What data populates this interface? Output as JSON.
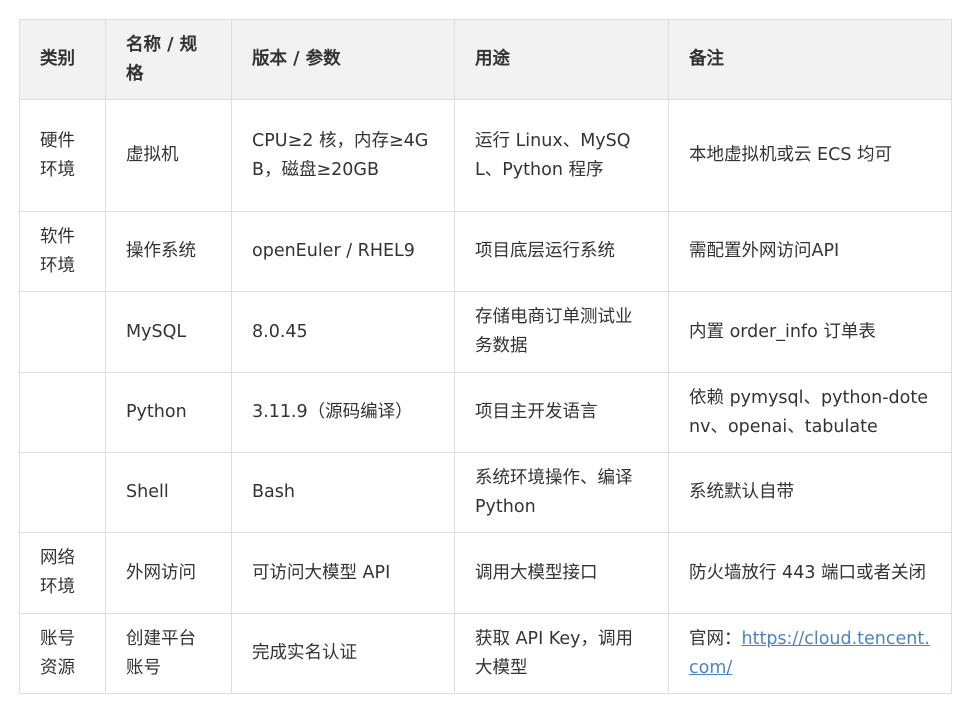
{
  "table": {
    "headers": [
      "类别",
      "名称 / 规格",
      "版本 / 参数",
      "用途",
      "备注"
    ],
    "rows": [
      {
        "category": "硬件环境",
        "name": "虚拟机",
        "version": "CPU≥2 核，内存≥4GB，磁盘≥20GB",
        "purpose": "运行 Linux、MySQL、Python 程序",
        "note": "本地虚拟机或云 ECS 均可"
      },
      {
        "category": "软件环境",
        "name": "操作系统",
        "version": "openEuler / RHEL9",
        "purpose": "项目底层运行系统",
        "note": "需配置外网访问API"
      },
      {
        "category": "",
        "name": "MySQL",
        "version": "8.0.45",
        "purpose": "存储电商订单测试业务数据",
        "note": "内置 order_info 订单表"
      },
      {
        "category": "",
        "name": "Python",
        "version": "3.11.9（源码编译）",
        "purpose": "项目主开发语言",
        "note": "依赖 pymysql、python-dotenv、openai、tabulate"
      },
      {
        "category": "",
        "name": "Shell",
        "version": "Bash",
        "purpose": "系统环境操作、编译 Python",
        "note": "系统默认自带"
      },
      {
        "category": "网络环境",
        "name": "外网访问",
        "version": "可访问大模型 API",
        "purpose": "调用大模型接口",
        "note": "防火墙放行 443 端口或者关闭"
      },
      {
        "category": "账号资源",
        "name": "创建平台账号",
        "version": "完成实名认证",
        "purpose": "获取 API Key，调用大模型",
        "note_prefix": "官网：",
        "note_link": "https://cloud.tencent.com/"
      }
    ]
  },
  "colors": {
    "header_bg": "#f2f2f2",
    "border": "#dedede",
    "text": "#333333",
    "link": "#4a84c4"
  }
}
